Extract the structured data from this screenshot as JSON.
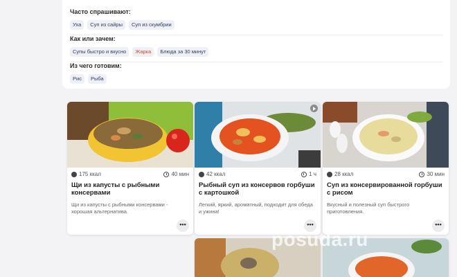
{
  "faq": {
    "groups": [
      {
        "title": "Часто спрашивают:",
        "chips": [
          "Уха",
          "Суп из сайры",
          "Суп из скумбрии"
        ]
      },
      {
        "title": "Как или зачем:",
        "chips": [
          "Супы быстро и вкусно",
          "Жарка",
          "Блюда за 30 минут"
        ]
      },
      {
        "title": "Из чего готовим:",
        "chips": [
          "Рис",
          "Рыба"
        ]
      }
    ]
  },
  "cards": [
    {
      "kcal": "175 ккал",
      "time": "40 мин",
      "title": "Щи из капусты с рыбными консервами",
      "desc": "Щи из капусты с рыбными консервами - хорошая альтернатива.",
      "more": "•••"
    },
    {
      "kcal": "42 ккал",
      "time": "1 ч",
      "title": "Рыбный суп из консервов горбуши с картошкой",
      "desc": "Легкий, яркий, ароматный, подходит для обеда и ужина!",
      "more": "•••"
    },
    {
      "kcal": "28 ккал",
      "time": "30 мин",
      "title": "Суп из консервированной горбуши с рисом",
      "desc": "Вкусный и полезный суп быстрого приготовления.",
      "more": "•••"
    }
  ],
  "watermark": "posuda.ru",
  "colors": {
    "chip_text": "#303b63",
    "chip_hot": "#d4472a",
    "chip_bg": "#eef0f6",
    "accent": "#f08a24"
  }
}
